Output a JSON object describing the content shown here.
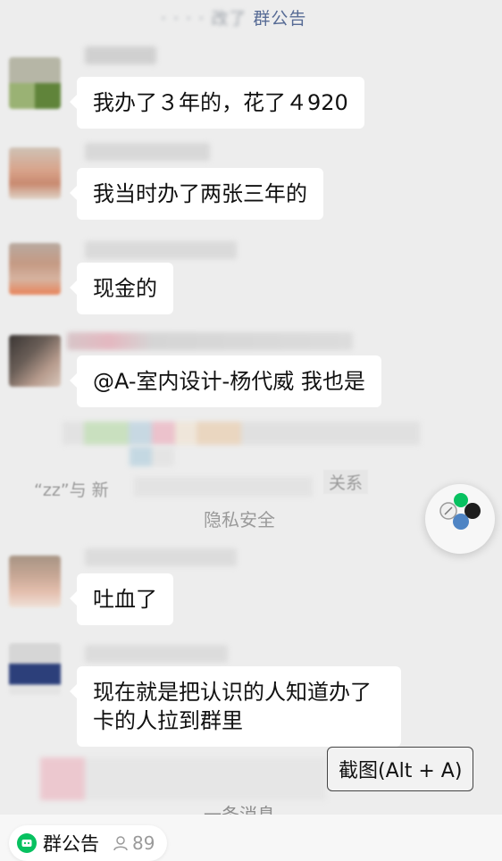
{
  "header_notice": {
    "prefix_blurred": "· · · · 改了",
    "link": "群公告"
  },
  "messages": [
    {
      "text": "我办了３年的，花了４920"
    },
    {
      "text": "我当时办了两张三年的"
    },
    {
      "text": "现金的"
    },
    {
      "text": "@A-室内设计-杨代威 我也是"
    },
    {
      "text": "吐血了"
    },
    {
      "text": "现在就是把认识的人知道办了卡的人拉到群里"
    }
  ],
  "system": {
    "partial_left": "“zz”与 新",
    "partial_right": "关系",
    "privacy": "隐私安全",
    "bottom_partial": "一条消息"
  },
  "screenshot_tip": "截图(Alt + A)",
  "bottom_bar": {
    "notice_label": "群公告",
    "member_count": "89"
  },
  "colors": {
    "background": "#ededed",
    "bubble": "#ffffff",
    "link": "#576b95",
    "wechat_green": "#07c160"
  }
}
